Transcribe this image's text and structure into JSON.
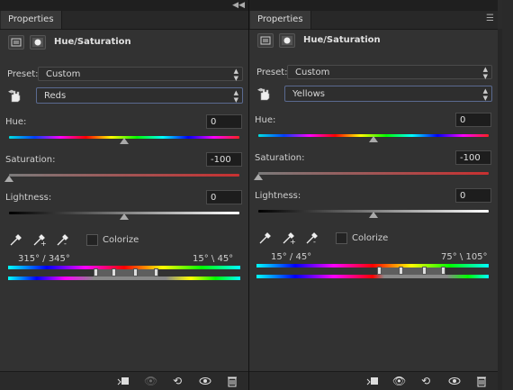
{
  "panels": [
    {
      "tab_label": "Properties",
      "adjustment_title": "Hue/Saturation",
      "preset_label": "Preset:",
      "preset_value": "Custom",
      "channel_value": "Reds",
      "hue_label": "Hue:",
      "hue_value": "0",
      "saturation_label": "Saturation:",
      "saturation_value": "-100",
      "lightness_label": "Lightness:",
      "lightness_value": "0",
      "colorize_label": "Colorize",
      "range_left": "315° / 345°",
      "range_right": "15° \\ 45°"
    },
    {
      "tab_label": "Properties",
      "adjustment_title": "Hue/Saturation",
      "preset_label": "Preset:",
      "preset_value": "Custom",
      "channel_value": "Yellows",
      "hue_label": "Hue:",
      "hue_value": "0",
      "saturation_label": "Saturation:",
      "saturation_value": "-100",
      "lightness_label": "Lightness:",
      "lightness_value": "0",
      "colorize_label": "Colorize",
      "range_left": "15° / 45°",
      "range_right": "75° \\ 105°"
    }
  ],
  "icons": {
    "collapse": "double-chevron-left-icon",
    "panel_menu": "panel-menu-icon",
    "footer": [
      "clip-to-layer-icon",
      "view-previous-state-icon",
      "reset-icon",
      "visibility-eye-icon",
      "trash-icon"
    ]
  },
  "colors": {
    "panel_bg": "#323232",
    "saturation_track": "#c83030",
    "selection_border": "#5a6a90"
  }
}
